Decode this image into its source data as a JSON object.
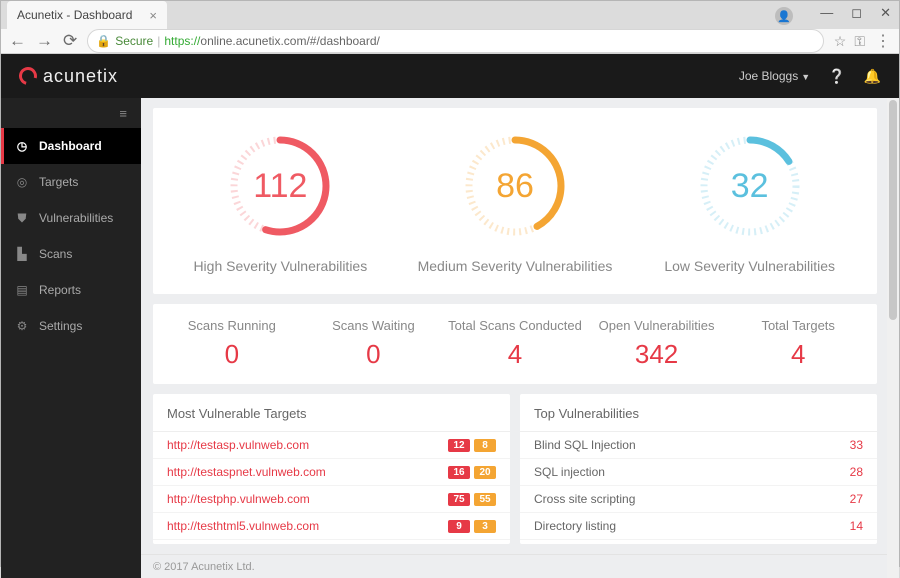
{
  "browser": {
    "tab_title": "Acunetix - Dashboard",
    "secure_label": "Secure",
    "url_prefix": "https://",
    "url": "online.acunetix.com/#/dashboard/"
  },
  "header": {
    "brand": "acunetix",
    "user": "Joe Bloggs"
  },
  "sidebar": {
    "items": [
      {
        "icon": "◷",
        "label": "Dashboard",
        "active": true
      },
      {
        "icon": "◎",
        "label": "Targets"
      },
      {
        "icon": "⛊",
        "label": "Vulnerabilities"
      },
      {
        "icon": "▙",
        "label": "Scans"
      },
      {
        "icon": "▤",
        "label": "Reports"
      },
      {
        "icon": "⚙",
        "label": "Settings"
      }
    ]
  },
  "gauges": [
    {
      "value": "112",
      "label": "High Severity Vulnerabilities",
      "color": "#ef5a63",
      "pct": 0.55
    },
    {
      "value": "86",
      "label": "Medium Severity Vulnerabilities",
      "color": "#f4a533",
      "pct": 0.42
    },
    {
      "value": "32",
      "label": "Low Severity Vulnerabilities",
      "color": "#5bc0de",
      "pct": 0.16
    }
  ],
  "stats": [
    {
      "label": "Scans Running",
      "value": "0"
    },
    {
      "label": "Scans Waiting",
      "value": "0"
    },
    {
      "label": "Total Scans Conducted",
      "value": "4"
    },
    {
      "label": "Open Vulnerabilities",
      "value": "342"
    },
    {
      "label": "Total Targets",
      "value": "4"
    }
  ],
  "most_vuln": {
    "title": "Most Vulnerable Targets",
    "rows": [
      {
        "url": "http://testasp.vulnweb.com",
        "red": "12",
        "org": "8"
      },
      {
        "url": "http://testaspnet.vulnweb.com",
        "red": "16",
        "org": "20"
      },
      {
        "url": "http://testphp.vulnweb.com",
        "red": "75",
        "org": "55"
      },
      {
        "url": "http://testhtml5.vulnweb.com",
        "red": "9",
        "org": "3"
      }
    ]
  },
  "top_vuln": {
    "title": "Top Vulnerabilities",
    "rows": [
      {
        "name": "Blind SQL Injection",
        "count": "33"
      },
      {
        "name": "SQL injection",
        "count": "28"
      },
      {
        "name": "Cross site scripting",
        "count": "27"
      },
      {
        "name": "Directory listing",
        "count": "14"
      }
    ]
  },
  "footer": "© 2017 Acunetix Ltd."
}
